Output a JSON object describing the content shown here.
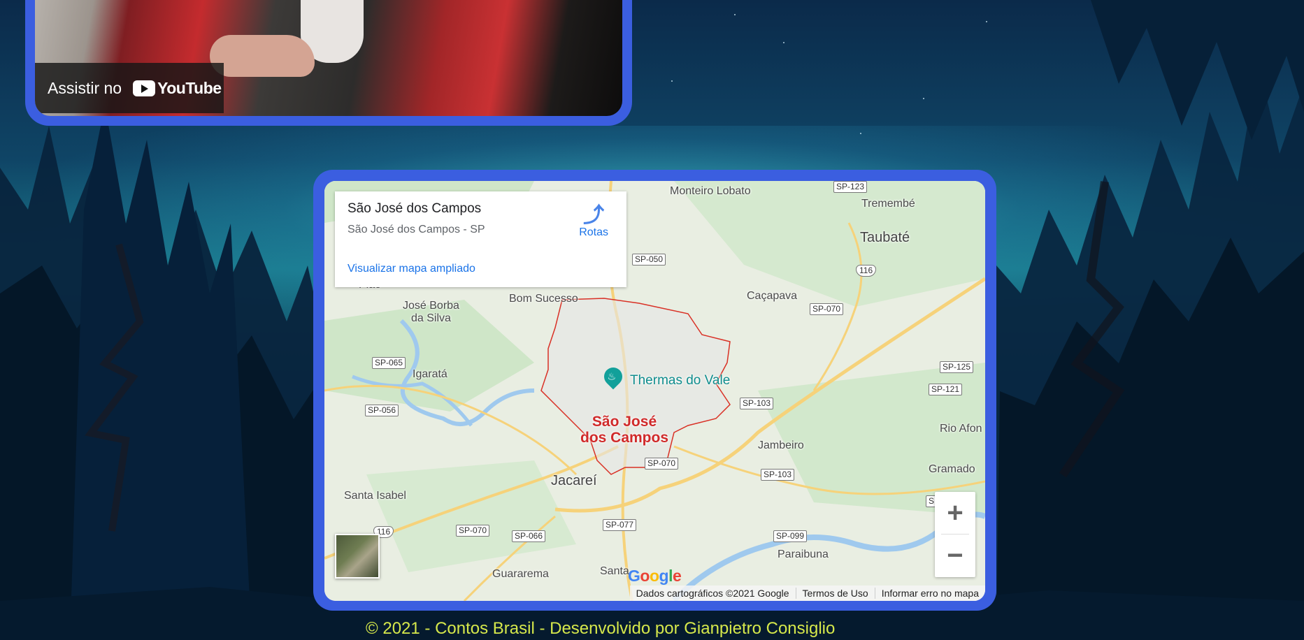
{
  "video": {
    "watch_on_label": "Assistir no",
    "platform_name": "YouTube"
  },
  "map": {
    "card": {
      "title": "São José dos Campos",
      "subtitle": "São José dos Campos - SP",
      "directions_label": "Rotas",
      "larger_map_link": "Visualizar mapa ampliado"
    },
    "highlighted_city": "São José\ndos Campos",
    "poi_name": "Thermas do Vale",
    "places": [
      "Monteiro\nLobato",
      "Tremembé",
      "Taubaté",
      "Pião",
      "Bom Sucesso",
      "José Borba\nda Silva",
      "Caçapava",
      "Igaratá",
      "Jambeiro",
      "Rio Afon",
      "Gramado",
      "Santa Isabel",
      "Jacareí",
      "Paraibuna",
      "Guararema",
      "Santa"
    ],
    "road_shields": [
      "SP-123",
      "SP-050",
      "116",
      "SP-070",
      "SP-065",
      "SP-125",
      "SP-121",
      "SP-056",
      "SP-103",
      "SP-070",
      "SP-103",
      "116",
      "SP-070",
      "SP-066",
      "SP-077",
      "SP-099",
      "S"
    ],
    "zoom_in_symbol": "+",
    "zoom_out_symbol": "−",
    "attribution": {
      "data": "Dados cartográficos ©2021 Google",
      "terms": "Termos de Uso",
      "report": "Informar erro no mapa"
    },
    "colors": {
      "boundary": "#d93025",
      "link": "#1a73e8",
      "frame": "#3b5ee0"
    }
  },
  "footer": {
    "text": "© 2021 - Contos Brasil - Desenvolvido por Gianpietro Consiglio"
  }
}
